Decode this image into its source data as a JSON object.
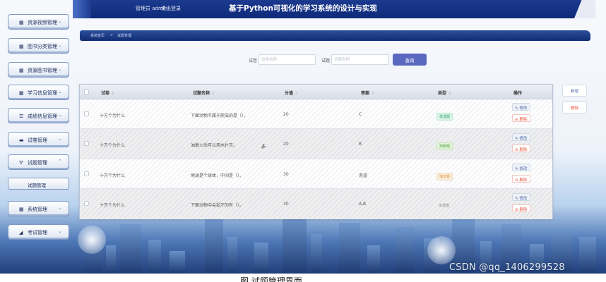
{
  "header": {
    "admin_text": "管理员 admin",
    "logout_text": "退出登录",
    "title": "基于Python可视化的学习系统的设计与实现"
  },
  "sidebar": {
    "items": [
      {
        "label": "资源视频管理",
        "icon": "grid-icon"
      },
      {
        "label": "图书分类管理",
        "icon": "grid-icon"
      },
      {
        "label": "资源图书管理",
        "icon": "grid-icon"
      },
      {
        "label": "学习信息管理",
        "icon": "grid-icon"
      },
      {
        "label": "成绩信息管理",
        "icon": "list-icon"
      },
      {
        "label": "试卷管理",
        "icon": "monitor-icon"
      },
      {
        "label": "试题管理",
        "icon": "filter-icon"
      },
      {
        "label": "试题管理"
      },
      {
        "label": "系统管理",
        "icon": "grid-icon"
      },
      {
        "label": "考试管理",
        "icon": "chart-icon"
      }
    ]
  },
  "breadcrumb": {
    "home": "系统首页",
    "sep": ">",
    "current": "试题管理"
  },
  "search": {
    "paper_label": "试卷",
    "paper_placeholder": "试卷名称",
    "question_label": "试题",
    "question_placeholder": "试题名称",
    "button": "查询"
  },
  "table": {
    "columns": [
      "试卷",
      "试题名称",
      "分值",
      "答案",
      "类型",
      "操作"
    ],
    "sort_glyph": "⇕",
    "edit_label": "✎ 修改",
    "delete_label": "⊖ 删除",
    "rows": [
      {
        "paper": "十万个为什么",
        "question": "下面动物不属于爬虫的是（）。",
        "score": "20",
        "answer": "C",
        "type": "单选题",
        "type_style": "single"
      },
      {
        "paper": "十万个为什么",
        "question": "油着火后可以用水扑灭。",
        "score": "20",
        "answer": "B",
        "type": "判断题",
        "type_style": "tf"
      },
      {
        "paper": "十万个为什么",
        "question": "地球是个球体，中间是（）。",
        "score": "30",
        "answer": "赤道",
        "type": "填空题",
        "type_style": "fill"
      },
      {
        "paper": "十万个为什么",
        "question": "下面动物中会捉汗的有（）。",
        "score": "30",
        "answer": "A,B",
        "type": "多选题",
        "type_style": "sub"
      }
    ]
  },
  "actions": {
    "add": "新增",
    "delete": "删除"
  },
  "colors": {
    "accent": "#5a68bf",
    "header": "#0e2a79",
    "danger": "#e5553f"
  },
  "watermark": "CSDN @qq_1406299528",
  "caption": "图 试题管理界面"
}
